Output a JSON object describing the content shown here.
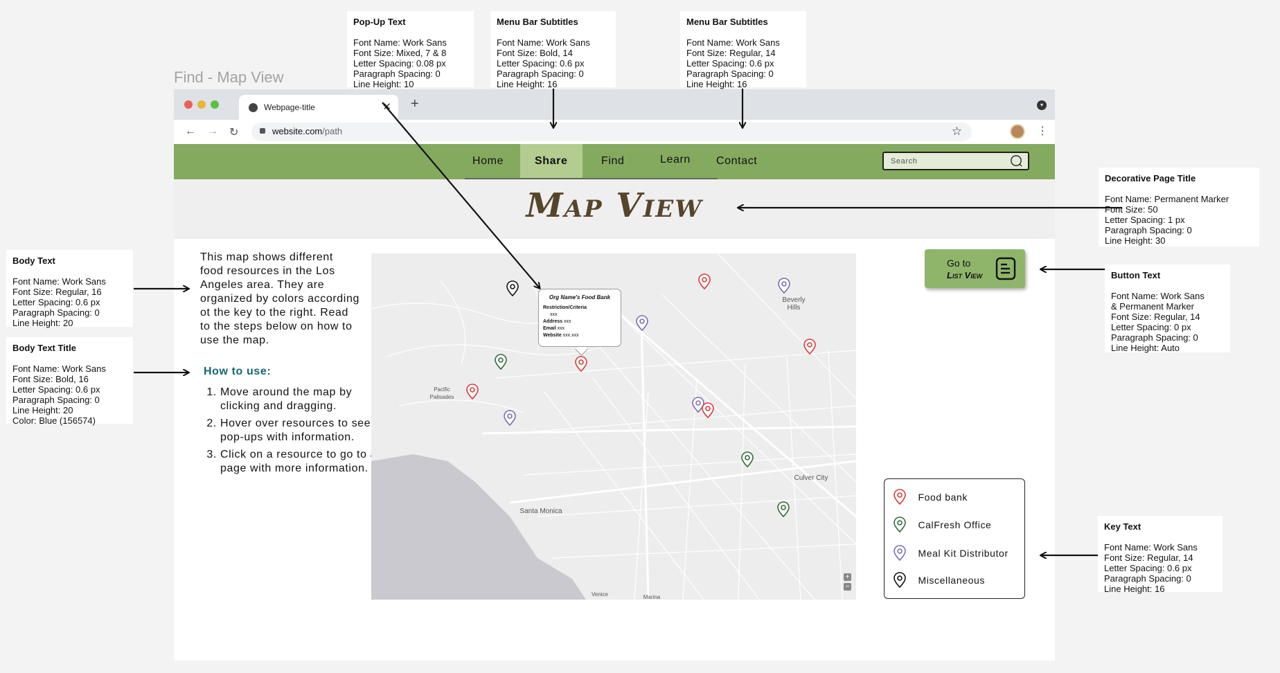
{
  "page_label": "Find - Map View",
  "annotations": {
    "popup_text": {
      "title": "Pop-Up Text",
      "lines": [
        "Font Name: Work Sans",
        "Font Size: Mixed, 7 & 8",
        "Letter Spacing: 0.08 px",
        "Paragraph Spacing: 0",
        "Line Height: 10"
      ]
    },
    "menu_bold": {
      "title": "Menu Bar Subtitles",
      "lines": [
        "Font Name: Work Sans",
        "Font Size: Bold, 14",
        "Letter Spacing: 0.6 px",
        "Paragraph Spacing: 0",
        "Line Height: 16"
      ]
    },
    "menu_regular": {
      "title": "Menu Bar Subtitles",
      "lines": [
        "Font Name: Work Sans",
        "Font Size: Regular, 14",
        "Letter Spacing: 0.6 px",
        "Paragraph Spacing: 0",
        "Line Height: 16"
      ]
    },
    "page_title": {
      "title": "Decorative Page Title",
      "lines": [
        "Font Name: Permanent Marker",
        "Font Size: 50",
        "Letter Spacing: 1 px",
        "Paragraph Spacing: 0",
        "Line Height: 30"
      ]
    },
    "button_text": {
      "title": "Button Text",
      "lines": [
        "Font Name: Work Sans",
        "& Permanent Marker",
        "Font Size: Regular, 14",
        "Letter Spacing: 0 px",
        "Paragraph Spacing: 0",
        "Line Height: Auto"
      ]
    },
    "key_text": {
      "title": "Key Text",
      "lines": [
        "Font Name: Work Sans",
        "Font Size: Regular, 14",
        "Letter Spacing: 0.6 px",
        "Paragraph Spacing: 0",
        "Line Height: 16"
      ]
    },
    "body_text": {
      "title": "Body Text",
      "lines": [
        "Font Name: Work Sans",
        "Font Size: Regular, 16",
        "Letter Spacing: 0.6 px",
        "Paragraph Spacing: 0",
        "Line Height: 20"
      ]
    },
    "body_title": {
      "title": "Body Text Title",
      "lines": [
        "Font Name: Work Sans",
        "Font Size: Bold, 16",
        "Letter Spacing: 0.6 px",
        "Paragraph Spacing: 0",
        "Line Height: 20",
        "Color: Blue (156574)"
      ]
    }
  },
  "browser": {
    "tab_title": "Webpage-title",
    "tab_close": "✕",
    "new_tab": "+",
    "url_host": "website.com",
    "url_path": "/path"
  },
  "nav": {
    "items": [
      "Home",
      "Share",
      "Find",
      "Learn",
      "Contact"
    ],
    "active": "Share",
    "search_placeholder": "Search"
  },
  "title": "Map View",
  "body": {
    "intro": "This map shows different food resources in the Los Angeles area. They are organized by colors according ot the key to the right. Read to the steps below on how to use the map.",
    "howto_title": "How to use:",
    "steps": [
      "Move around the map by clicking and dragging.",
      "Hover over resources to see pop-ups with information.",
      "Click on a resource to go to a page with more information."
    ]
  },
  "map": {
    "labels": [
      "Beverly Hills",
      "Pacific Palisades",
      "Culver City",
      "Santa Monica",
      "Venice",
      "Marina"
    ],
    "zoom_in": "+",
    "zoom_out": "−"
  },
  "popup": {
    "title": "Org Name's Food Bank",
    "criteria_label": "Restriction/Criteria",
    "criteria_value": "xxx",
    "address_label": "Address",
    "address_value": "xxx",
    "email_label": "Email",
    "email_value": "xxx",
    "website_label": "Website",
    "website_value": "xxx.xxx"
  },
  "list_button": {
    "line1": "Go to",
    "line2": "List View"
  },
  "key": {
    "items": [
      {
        "label": "Food bank",
        "color": "#d93a3a"
      },
      {
        "label": "CalFresh Office",
        "color": "#2f6b3a"
      },
      {
        "label": "Meal Kit Distributor",
        "color": "#7b6bb8"
      },
      {
        "label": "Miscellaneous",
        "color": "#111111"
      }
    ]
  },
  "colors": {
    "nav_green": "#84aa5f",
    "nav_active": "#b2cd8f",
    "title_brown": "#55452b",
    "howto_blue": "#156574"
  }
}
